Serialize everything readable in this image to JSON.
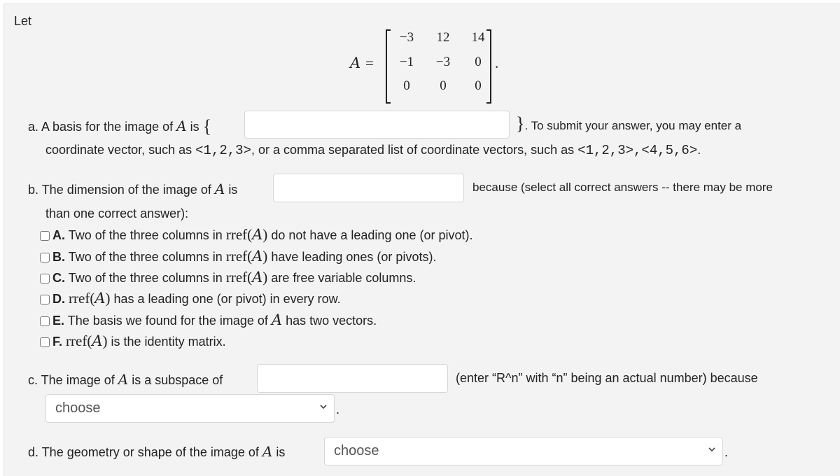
{
  "intro": "Let",
  "matrix": {
    "name": "A",
    "equals": "=",
    "rows": [
      [
        "−3",
        "12",
        "14"
      ],
      [
        "−1",
        "−3",
        "0"
      ],
      [
        "0",
        "0",
        "0"
      ]
    ],
    "trailing": "."
  },
  "part_a": {
    "prefix": "a. A basis for the image of",
    "var": "A",
    "is": "is",
    "open_brace": "{",
    "close_brace": "}",
    "after": ". To submit your answer, you may enter a",
    "line2_start": "coordinate vector, such as",
    "example1": "<1,2,3>",
    "line2_mid": ", or a comma separated list of coordinate vectors, such as",
    "example2": "<1,2,3>,<4,5,6>",
    "line2_end": ".",
    "input_value": ""
  },
  "part_b": {
    "prefix": "b. The dimension of the image of",
    "var": "A",
    "is": "is",
    "input_value": "",
    "after": "because (select all correct answers -- there may be more",
    "line2": "than one correct answer):",
    "options": [
      {
        "letter": "A.",
        "pre": "Two of the three columns in",
        "rref": "rref(",
        "var": "A",
        "close": ")",
        "post": "do not have a leading one (or pivot).",
        "checked": false
      },
      {
        "letter": "B.",
        "pre": "Two of the three columns in",
        "rref": "rref(",
        "var": "A",
        "close": ")",
        "post": "have leading ones (or pivots).",
        "checked": false
      },
      {
        "letter": "C.",
        "pre": "Two of the three columns in",
        "rref": "rref(",
        "var": "A",
        "close": ")",
        "post": "are free variable columns.",
        "checked": false
      },
      {
        "letter": "D.",
        "pre": "",
        "rref": "rref(",
        "var": "A",
        "close": ")",
        "post": "has a leading one (or pivot) in every row.",
        "checked": false
      },
      {
        "letter": "E.",
        "pre": "The basis we found for the image of",
        "rref": "",
        "var": "A",
        "close": "",
        "post": "has two vectors.",
        "checked": false
      },
      {
        "letter": "F.",
        "pre": "",
        "rref": "rref(",
        "var": "A",
        "close": ")",
        "post": "is the identity matrix.",
        "checked": false
      }
    ]
  },
  "part_c": {
    "prefix": "c. The image of",
    "var": "A",
    "after_var": "is a subspace of",
    "input_value": "",
    "hint": "(enter “R^n” with “n” being an actual number) because",
    "select_value": "choose",
    "trailing": "."
  },
  "part_d": {
    "prefix": "d. The geometry or shape of the image of",
    "var": "A",
    "is": "is",
    "select_value": "choose",
    "trailing": "."
  }
}
